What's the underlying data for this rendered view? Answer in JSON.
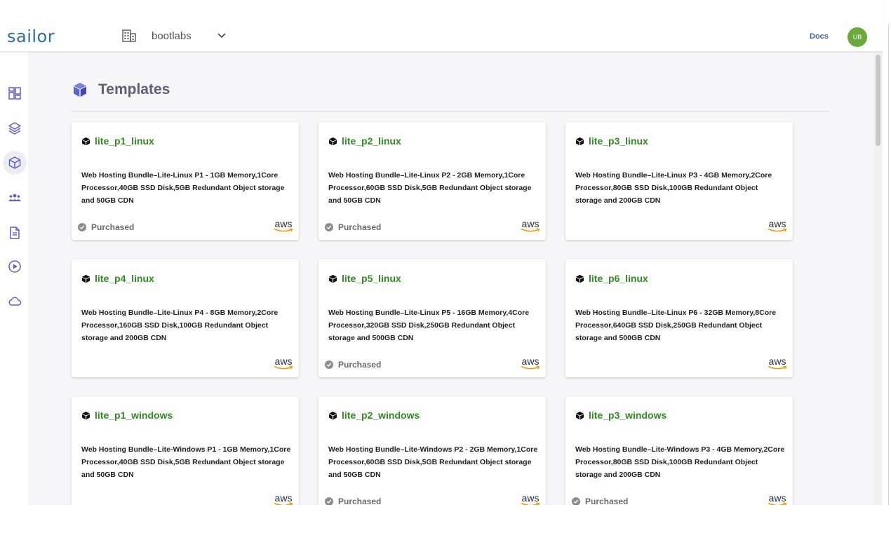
{
  "header": {
    "logo": "sailor",
    "org_name": "bootlabs",
    "docs_label": "Docs",
    "avatar_initials": "UB"
  },
  "sidebar": {
    "items": [
      {
        "icon": "dashboard-icon"
      },
      {
        "icon": "layers-icon"
      },
      {
        "icon": "cube-icon",
        "active": true
      },
      {
        "icon": "team-icon"
      },
      {
        "icon": "document-icon"
      },
      {
        "icon": "play-circle-icon"
      },
      {
        "icon": "cloud-icon"
      }
    ]
  },
  "page": {
    "title": "Templates"
  },
  "colors": {
    "accent": "#5c5fd6",
    "title_green": "#2e8b1f",
    "logo_blue": "#2a6fa3",
    "avatar_green": "#6aaa3a"
  },
  "cards": [
    {
      "title": "lite_p1_linux",
      "description": "Web Hosting Bundle–Lite-Linux P1 - 1GB Memory,1Core Processor,40GB SSD Disk,5GB Redundant Object storage and 50GB CDN",
      "status": "Purchased",
      "provider": "aws"
    },
    {
      "title": "lite_p2_linux",
      "description": "Web Hosting Bundle–Lite-Linux P2 - 2GB Memory,1Core Processor,60GB SSD Disk,5GB Redundant Object storage and 50GB CDN",
      "status": "Purchased",
      "provider": "aws"
    },
    {
      "title": "lite_p3_linux",
      "description": "Web Hosting Bundle–Lite-Linux P3 - 4GB Memory,2Core Processor,80GB SSD Disk,100GB Redundant Object storage and 200GB CDN",
      "status": "",
      "provider": "aws"
    },
    {
      "title": "lite_p4_linux",
      "description": "Web Hosting Bundle–Lite-Linux P4 - 8GB Memory,2Core Processor,160GB SSD Disk,100GB Redundant Object storage and 200GB CDN",
      "status": "",
      "provider": "aws"
    },
    {
      "title": "lite_p5_linux",
      "description": "Web Hosting Bundle–Lite-Linux P5 - 16GB Memory,4Core Processor,320GB SSD Disk,250GB Redundant Object storage and 500GB CDN",
      "status": "Purchased",
      "provider": "aws"
    },
    {
      "title": "lite_p6_linux",
      "description": "Web Hosting Bundle–Lite-Linux P6 - 32GB Memory,8Core Processor,640GB SSD Disk,250GB Redundant Object storage and 500GB CDN",
      "status": "",
      "provider": "aws"
    },
    {
      "title": "lite_p1_windows",
      "description": "Web Hosting Bundle–Lite-Windows P1 - 1GB Memory,1Core Processor,40GB SSD Disk,5GB Redundant Object storage and 50GB CDN",
      "status": "",
      "provider": "aws"
    },
    {
      "title": "lite_p2_windows",
      "description": "Web Hosting Bundle–Lite-Windows P2 - 2GB Memory,1Core Processor,60GB SSD Disk,5GB Redundant Object storage and 50GB CDN",
      "status": "Purchased",
      "provider": "aws"
    },
    {
      "title": "lite_p3_windows",
      "description": "Web Hosting Bundle–Lite-Windows P3 - 4GB Memory,2Core Processor,80GB SSD Disk,100GB Redundant Object storage and 200GB CDN",
      "status": "Purchased",
      "provider": "aws"
    }
  ]
}
